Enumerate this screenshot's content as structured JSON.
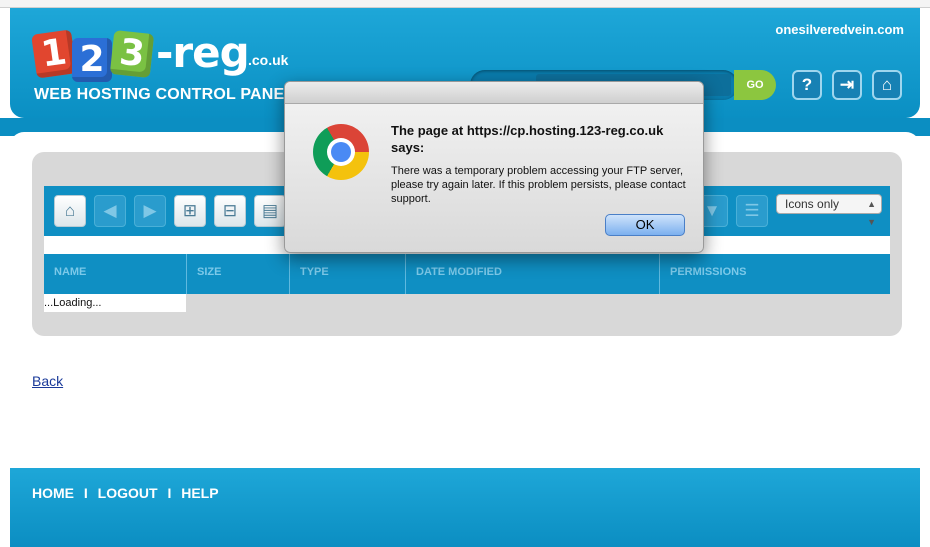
{
  "header": {
    "logo": {
      "digit1": "1",
      "digit2": "2",
      "digit3": "3",
      "reg": "-reg",
      "tld": ".co.uk"
    },
    "panel_title": "WEB HOSTING CONTROL PANEL",
    "domain": "onesilveredvein.com",
    "go_label": "GO",
    "buttons": {
      "help": "?",
      "logout": "⇥",
      "home": "⌂"
    }
  },
  "file_manager": {
    "view_select": "Icons only",
    "columns": [
      "NAME",
      "SIZE",
      "TYPE",
      "DATE MODIFIED",
      "PERMISSIONS"
    ],
    "loading": "...Loading..."
  },
  "back_link": "Back",
  "footer": {
    "home": "HOME",
    "sep": "I",
    "logout": "LOGOUT",
    "help": "HELP"
  },
  "dialog": {
    "title": "The page at https://cp.hosting.123-reg.co.uk says:",
    "message": "There was a temporary problem accessing your FTP server, please try again later. If this problem persists, please contact support.",
    "ok": "OK"
  },
  "colors": {
    "brand_blue": "#0f8fc3",
    "go_green": "#8cc63f",
    "cube_red": "#e1462f",
    "cube_blue": "#2b6fd6",
    "cube_green": "#7ac143"
  }
}
